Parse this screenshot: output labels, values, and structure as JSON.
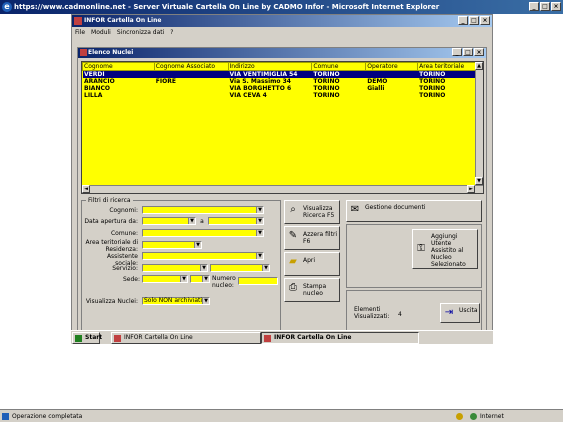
{
  "browser": {
    "title": "https://www.cadmonline.net - Server Virtuale Cartella On Line by CADMO Infor - Microsoft Internet Explorer",
    "status_text": "Operazione completata",
    "zone": "Internet"
  },
  "app": {
    "title": "INFOR Cartella On Line",
    "menu": [
      "File",
      "Moduli",
      "Sincronizza dati",
      "?"
    ]
  },
  "child": {
    "title": "Elenco Nuclei"
  },
  "grid": {
    "columns": [
      "Cognome",
      "Cognome Associato",
      "Indirizzo",
      "Comune",
      "Operatore",
      "Area teritoriale"
    ],
    "rows": [
      [
        "VERDI",
        "",
        "VIA VENTIMIGLIA 54",
        "TORINO",
        "",
        "TORINO"
      ],
      [
        "ARANCIO",
        "FIORE",
        "Via S. Massimo 34",
        "TORINO",
        "DEMO",
        "TORINO"
      ],
      [
        "BIANCO",
        "",
        "VIA BORGHETTO 6",
        "TORINO",
        "Gialli",
        "TORINO"
      ],
      [
        "LILLA",
        "",
        "VIA CEVA 4",
        "TORINO",
        "",
        "TORINO"
      ]
    ],
    "selected_row": 0
  },
  "filters": {
    "legend": "Filtri di ricerca",
    "cognomi_label": "Cognomi:",
    "data_apertura_label": "Data apertura da:",
    "a_label": "a",
    "comune_label": "Comune:",
    "area_label": "Area teritoriale di Residenza:",
    "assistente_label": "Assistente sociale:",
    "servizio_label": "Servizio:",
    "sede_label": "Sede:",
    "numero_nucleo_label": "Numero nucleo:",
    "visualizza_label": "Visualizza Nuclei:",
    "visualizza_value": "Solo NON archiviati"
  },
  "buttons": {
    "visualizza_ricerca": "Visualizza Ricerca F5",
    "azzera_filtri": "Azzera filtri F6",
    "apri": "Apri",
    "stampa_nucleo": "Stampa nucleo",
    "gestione_documenti": "Gestione documenti",
    "aggiungi_utente": "Aggiungi Utente Assistito al Nucleo Selezionato",
    "uscita": "Uscita"
  },
  "elementi": {
    "label": "Elementi Visualizzati:",
    "count": "4"
  },
  "taskbar": {
    "start": "Start",
    "items": [
      "INFOR Cartella On Line",
      "INFOR Cartella On Line"
    ]
  }
}
